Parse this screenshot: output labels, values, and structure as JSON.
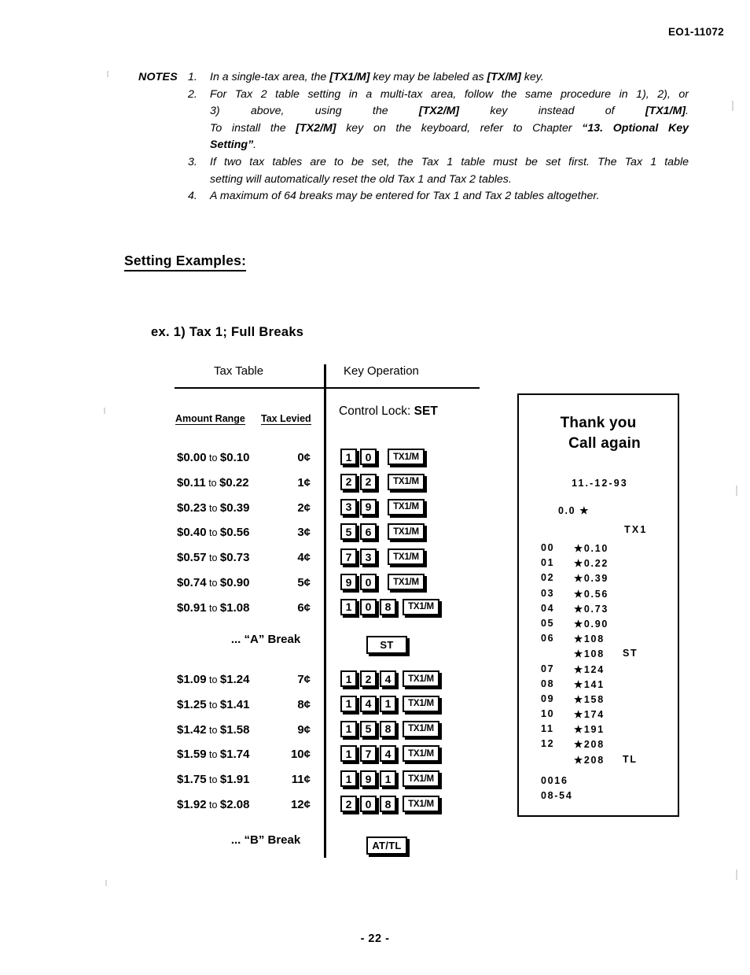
{
  "header": {
    "doc_code": "EO1-11072"
  },
  "notes": {
    "label": "NOTES",
    "items": [
      {
        "num": "1.",
        "lines": [
          [
            {
              "t": "In a single-tax area, the ",
              "b": false
            },
            {
              "t": "[TX1/M]",
              "b": true
            },
            {
              "t": " key may be labeled as ",
              "b": false
            },
            {
              "t": "[TX/M]",
              "b": true
            },
            {
              "t": " key.",
              "b": false
            }
          ]
        ]
      },
      {
        "num": "2.",
        "lines": [
          [
            {
              "t": "For Tax 2 table setting in a multi-tax area, follow the same procedure in 1), 2), or",
              "b": false
            }
          ],
          [
            {
              "t": "3) above, using the ",
              "b": false
            },
            {
              "t": "[TX2/M]",
              "b": true
            },
            {
              "t": " key instead of ",
              "b": false
            },
            {
              "t": "[TX1/M]",
              "b": true
            },
            {
              "t": ".",
              "b": false
            }
          ],
          [
            {
              "t": "To install the ",
              "b": false
            },
            {
              "t": "[TX2/M]",
              "b": true
            },
            {
              "t": " key on the keyboard, refer to Chapter ",
              "b": false
            },
            {
              "t": "“13. Optional Key",
              "b": true
            }
          ],
          [
            {
              "t": "Setting”",
              "b": true
            },
            {
              "t": ".",
              "b": false
            }
          ]
        ]
      },
      {
        "num": "3.",
        "lines": [
          [
            {
              "t": "If two tax tables are to be set, the Tax 1 table must be set first.  The Tax 1 table",
              "b": false
            }
          ],
          [
            {
              "t": "setting will automatically reset the old Tax 1 and Tax 2 tables.",
              "b": false
            }
          ]
        ]
      },
      {
        "num": "4.",
        "lines": [
          [
            {
              "t": "A maximum of 64 breaks may be entered for Tax 1 and Tax 2 tables altogether.",
              "b": false
            }
          ]
        ]
      }
    ]
  },
  "setting_examples_heading": "Setting Examples:",
  "example_heading": "ex. 1)  Tax 1; Full Breaks",
  "table": {
    "col_head_tax_table": "Tax Table",
    "col_head_key_operation": "Key Operation",
    "subhead_amount_range": "Amount Range",
    "subhead_tax_levied": "Tax Levied",
    "control_lock_label": "Control Lock: ",
    "control_lock_value": "SET",
    "break_a": "... “A” Break",
    "break_b": "... “B” Break",
    "group1": [
      {
        "from": "$0.00",
        "to": "to",
        "upto": "$0.10",
        "tax": "0¢",
        "keys": [
          "1",
          "0"
        ],
        "func": "TX1/M"
      },
      {
        "from": "$0.11",
        "to": "to",
        "upto": "$0.22",
        "tax": "1¢",
        "keys": [
          "2",
          "2"
        ],
        "func": "TX1/M"
      },
      {
        "from": "$0.23",
        "to": "to",
        "upto": "$0.39",
        "tax": "2¢",
        "keys": [
          "3",
          "9"
        ],
        "func": "TX1/M"
      },
      {
        "from": "$0.40",
        "to": "to",
        "upto": "$0.56",
        "tax": "3¢",
        "keys": [
          "5",
          "6"
        ],
        "func": "TX1/M"
      },
      {
        "from": "$0.57",
        "to": "to",
        "upto": "$0.73",
        "tax": "4¢",
        "keys": [
          "7",
          "3"
        ],
        "func": "TX1/M"
      },
      {
        "from": "$0.74",
        "to": "to",
        "upto": "$0.90",
        "tax": "5¢",
        "keys": [
          "9",
          "0"
        ],
        "func": "TX1/M"
      },
      {
        "from": "$0.91",
        "to": "to",
        "upto": "$1.08",
        "tax": "6¢",
        "keys": [
          "1",
          "0",
          "8"
        ],
        "func": "TX1/M"
      }
    ],
    "group2": [
      {
        "from": "$1.09",
        "to": "to",
        "upto": "$1.24",
        "tax": "7¢",
        "keys": [
          "1",
          "2",
          "4"
        ],
        "func": "TX1/M"
      },
      {
        "from": "$1.25",
        "to": "to",
        "upto": "$1.41",
        "tax": "8¢",
        "keys": [
          "1",
          "4",
          "1"
        ],
        "func": "TX1/M"
      },
      {
        "from": "$1.42",
        "to": "to",
        "upto": "$1.58",
        "tax": "9¢",
        "keys": [
          "1",
          "5",
          "8"
        ],
        "func": "TX1/M"
      },
      {
        "from": "$1.59",
        "to": "to",
        "upto": "$1.74",
        "tax": "10¢",
        "keys": [
          "1",
          "7",
          "4"
        ],
        "func": "TX1/M"
      },
      {
        "from": "$1.75",
        "to": "to",
        "upto": "$1.91",
        "tax": "11¢",
        "keys": [
          "1",
          "9",
          "1"
        ],
        "func": "TX1/M"
      },
      {
        "from": "$1.92",
        "to": "to",
        "upto": "$2.08",
        "tax": "12¢",
        "keys": [
          "2",
          "0",
          "8"
        ],
        "func": "TX1/M"
      }
    ],
    "key_st": "ST",
    "key_attl": "AT/TL"
  },
  "receipt": {
    "title_line1": "Thank you",
    "title_line2": "Call  again",
    "date": "11.-12-93",
    "zero_line": "0.0 ★",
    "tx_label": "TX1",
    "lines": [
      {
        "idx": "00",
        "val": "★0.10",
        "tag": ""
      },
      {
        "idx": "01",
        "val": "★0.22",
        "tag": ""
      },
      {
        "idx": "02",
        "val": "★0.39",
        "tag": ""
      },
      {
        "idx": "03",
        "val": "★0.56",
        "tag": ""
      },
      {
        "idx": "04",
        "val": "★0.73",
        "tag": ""
      },
      {
        "idx": "05",
        "val": "★0.90",
        "tag": ""
      },
      {
        "idx": "06",
        "val": "★108",
        "tag": ""
      },
      {
        "idx": "",
        "val": "★108",
        "tag": "ST"
      },
      {
        "idx": "07",
        "val": "★124",
        "tag": ""
      },
      {
        "idx": "08",
        "val": "★141",
        "tag": ""
      },
      {
        "idx": "09",
        "val": "★158",
        "tag": ""
      },
      {
        "idx": "10",
        "val": "★174",
        "tag": ""
      },
      {
        "idx": "11",
        "val": "★191",
        "tag": ""
      },
      {
        "idx": "12",
        "val": "★208",
        "tag": ""
      },
      {
        "idx": "",
        "val": "★208",
        "tag": "TL"
      }
    ],
    "footer_line1": "0016",
    "footer_line2": "08-54"
  },
  "page_number": "- 22 -"
}
